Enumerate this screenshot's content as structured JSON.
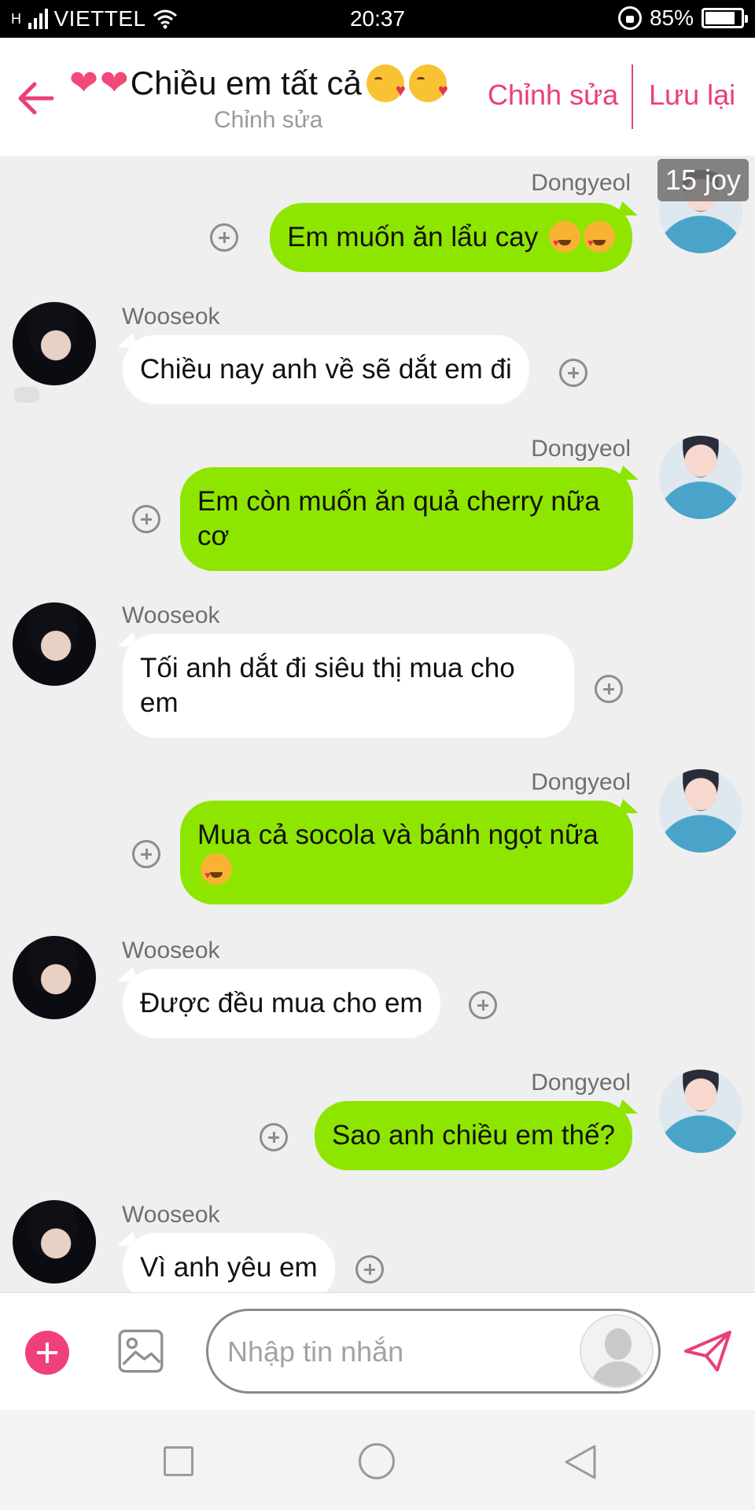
{
  "status_bar": {
    "carrier": "VIETTEL",
    "network_glyph": "H",
    "time": "20:37",
    "battery": "85%",
    "battery_level": 0.85
  },
  "header": {
    "title": "Chiều em tất cả",
    "subtitle": "Chỉnh sửa",
    "edit_label": "Chỉnh sửa",
    "save_label": "Lưu lại",
    "accent_color": "#e8407a"
  },
  "overlay_badge": "15 joy",
  "messages": [
    {
      "side": "right",
      "sender": "Dongyeol",
      "text": "Em muốn ăn lẩu cay"
    },
    {
      "side": "left",
      "sender": "Wooseok",
      "text": "Chiều nay anh về sẽ dắt em đi"
    },
    {
      "side": "right",
      "sender": "Dongyeol",
      "text": "Em còn muốn ăn quả cherry nữa cơ"
    },
    {
      "side": "left",
      "sender": "Wooseok",
      "text": "Tối anh dắt đi siêu thị mua cho em"
    },
    {
      "side": "right",
      "sender": "Dongyeol",
      "text": "Mua cả socola và bánh ngọt nữa"
    },
    {
      "side": "left",
      "sender": "Wooseok",
      "text": "Được đều mua cho em"
    },
    {
      "side": "right",
      "sender": "Dongyeol",
      "text": "Sao anh chiều em thế?"
    },
    {
      "side": "left",
      "sender": "Wooseok",
      "text": "Vì anh yêu em"
    }
  ],
  "input": {
    "placeholder": "Nhập tin nhắn",
    "value": ""
  },
  "colors": {
    "right_bubble": "#8ee600",
    "left_bubble": "#ffffff",
    "background": "#efefef"
  }
}
